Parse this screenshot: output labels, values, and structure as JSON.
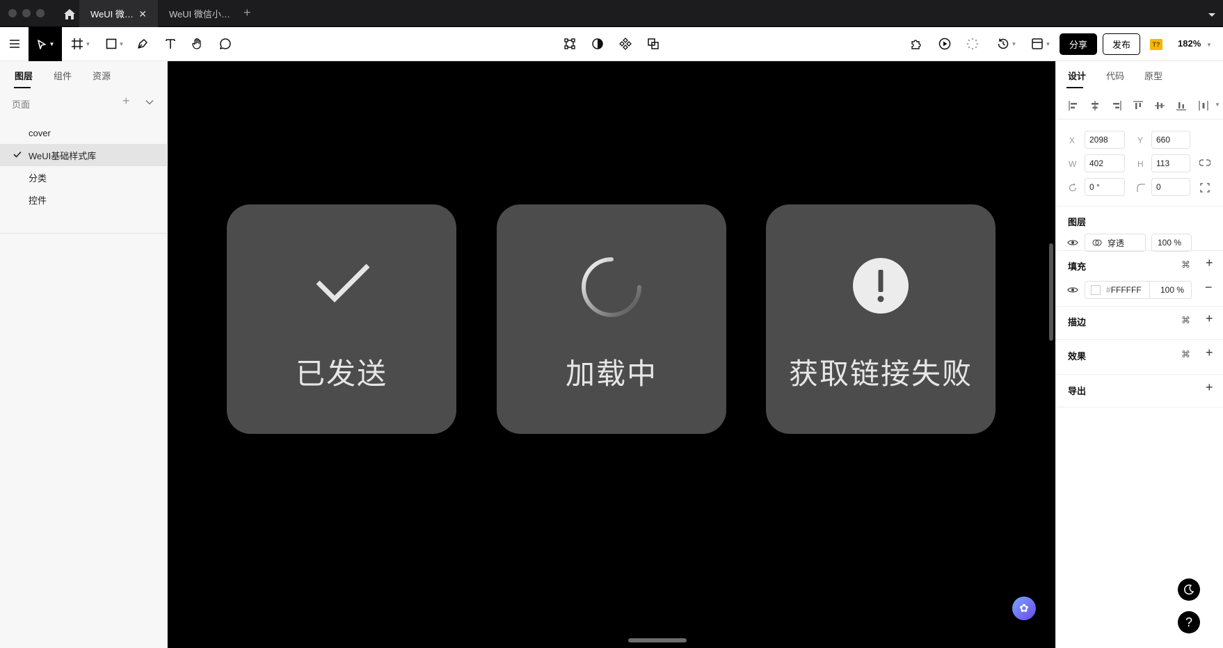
{
  "tabs": [
    {
      "label": "WeUI 微…",
      "active": true,
      "close": "✕"
    },
    {
      "label": "WeUI 微信小…",
      "active": false
    }
  ],
  "new_tab": "+",
  "toolbar": {
    "share_label": "分享",
    "publish_label": "发布",
    "badge": "T?",
    "zoom": "182%"
  },
  "left_panel": {
    "tabs": [
      "图层",
      "组件",
      "资源"
    ],
    "pages_label": "页面",
    "pages": [
      {
        "label": "cover",
        "selected": false
      },
      {
        "label": "WeUI基础样式库",
        "selected": true
      },
      {
        "label": "分类",
        "selected": false
      },
      {
        "label": "控件",
        "selected": false
      }
    ]
  },
  "canvas": {
    "toasts": [
      {
        "label": "已发送",
        "icon": "check-icon"
      },
      {
        "label": "加载中",
        "icon": "loading-spinner-icon"
      },
      {
        "label": "获取链接失败",
        "icon": "warning-icon"
      }
    ]
  },
  "right_panel": {
    "tabs": [
      "设计",
      "代码",
      "原型"
    ],
    "x_label": "X",
    "x": "2098",
    "y_label": "Y",
    "y": "660",
    "w_label": "W",
    "w": "402",
    "h_label": "H",
    "h": "113",
    "rotation": "0 °",
    "radius": "0",
    "layer_title": "图层",
    "blend_mode": "穿透",
    "layer_opacity": "100 %",
    "fill_title": "填充",
    "fill_hash": "#",
    "fill_color": "FFFFFF",
    "fill_opacity": "100 %",
    "stroke_title": "描边",
    "effect_title": "效果",
    "export_title": "导出"
  },
  "help": "?"
}
